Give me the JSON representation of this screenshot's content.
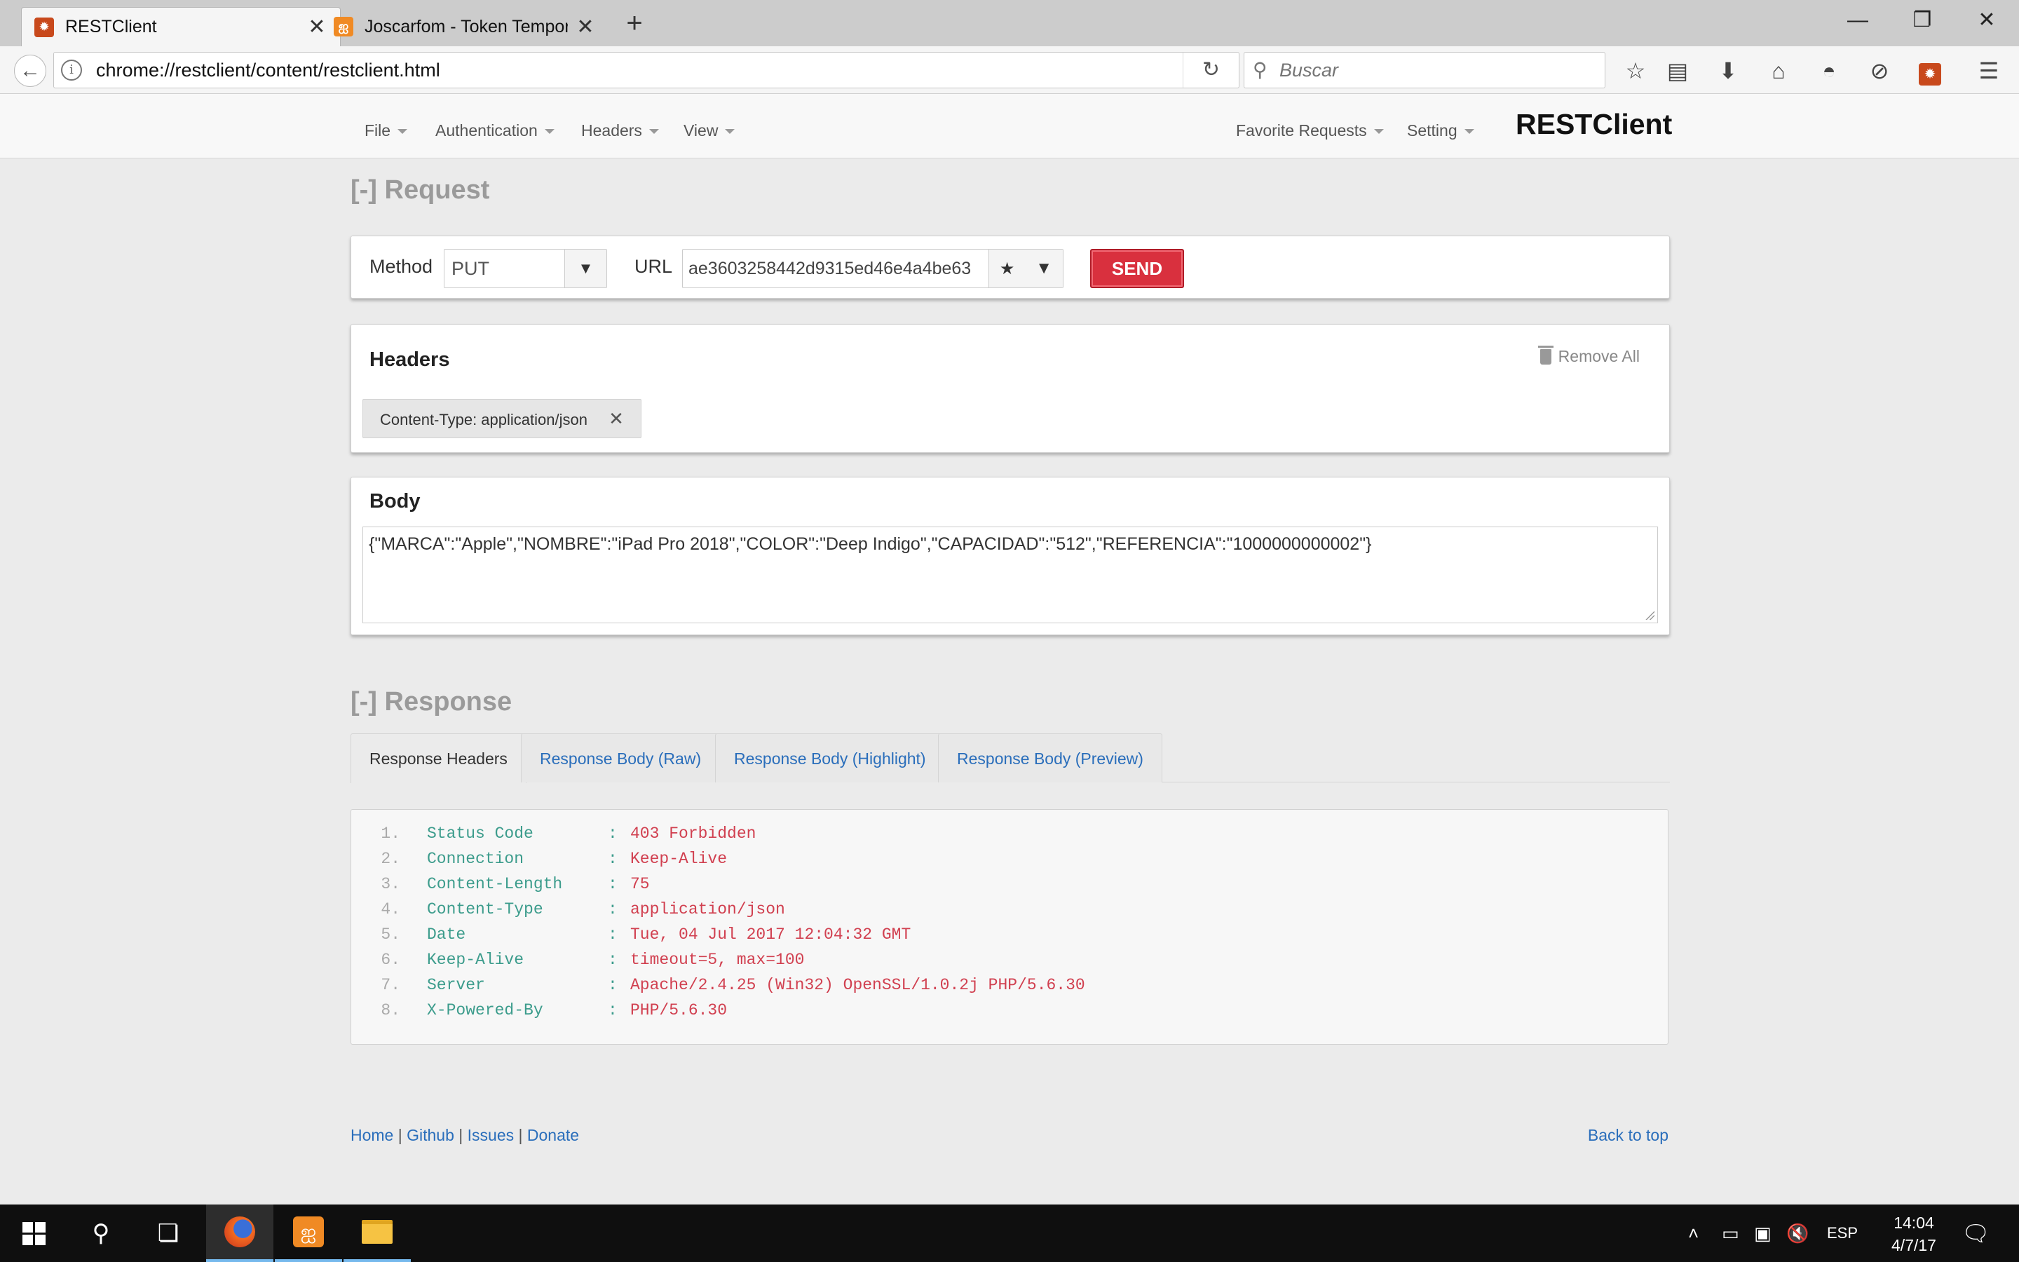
{
  "browser": {
    "tabs": [
      {
        "title": "RESTClient",
        "active": true
      },
      {
        "title": "Joscarfom - Token Temporal",
        "active": false
      }
    ],
    "address": "chrome://restclient/content/restclient.html",
    "search_placeholder": "Buscar",
    "icons": {
      "back": "arrow-left-icon",
      "info": "info-icon",
      "reload": "reload-icon",
      "bookmark": "star-icon",
      "reading": "reader-list-icon",
      "download": "download-icon",
      "home": "home-icon",
      "pocket": "pocket-icon",
      "sync": "sync-icon",
      "extension": "restclient-icon",
      "menu": "hamburger-icon"
    }
  },
  "app": {
    "brand": "RESTClient",
    "menu_left": [
      "File",
      "Authentication",
      "Headers",
      "View"
    ],
    "menu_right": [
      "Favorite Requests",
      "Setting"
    ],
    "request": {
      "title": "[-] Request",
      "method_label": "Method",
      "method_value": "PUT",
      "url_label": "URL",
      "url_value": "ae3603258442d9315ed46e4a4be63",
      "send_label": "SEND"
    },
    "headers": {
      "title": "Headers",
      "remove_all": "Remove All",
      "items": [
        "Content-Type: application/json"
      ]
    },
    "body": {
      "title": "Body",
      "content": "{\"MARCA\":\"Apple\",\"NOMBRE\":\"iPad Pro 2018\",\"COLOR\":\"Deep Indigo\",\"CAPACIDAD\":\"512\",\"REFERENCIA\":\"1000000000002\"}"
    },
    "response": {
      "title": "[-] Response",
      "tabs": [
        "Response Headers",
        "Response Body (Raw)",
        "Response Body (Highlight)",
        "Response Body (Preview)"
      ],
      "active_tab": "Response Headers",
      "headers": [
        {
          "num": "1.",
          "key": "Status Code",
          "value": "403 Forbidden"
        },
        {
          "num": "2.",
          "key": "Connection",
          "value": "Keep-Alive"
        },
        {
          "num": "3.",
          "key": "Content-Length",
          "value": "75"
        },
        {
          "num": "4.",
          "key": "Content-Type",
          "value": "application/json"
        },
        {
          "num": "5.",
          "key": "Date",
          "value": "Tue, 04 Jul 2017 12:04:32 GMT"
        },
        {
          "num": "6.",
          "key": "Keep-Alive",
          "value": "timeout=5, max=100"
        },
        {
          "num": "7.",
          "key": "Server",
          "value": "Apache/2.4.25 (Win32) OpenSSL/1.0.2j PHP/5.6.30"
        },
        {
          "num": "8.",
          "key": "X-Powered-By",
          "value": "PHP/5.6.30"
        }
      ],
      "separator": ":"
    },
    "footer": {
      "links": [
        "Home",
        "Github",
        "Issues",
        "Donate"
      ],
      "separator": "|",
      "back_to_top": "Back to top"
    }
  },
  "taskbar": {
    "apps": [
      "windows-start-icon",
      "search-icon",
      "task-view-icon",
      "firefox-icon",
      "xampp-icon",
      "file-explorer-icon"
    ],
    "language": "ESP",
    "time": "14:04",
    "date": "4/7/17"
  },
  "colors": {
    "send_button": "#d9303e",
    "link": "#2a6ebb",
    "response_key": "#3c9c8c",
    "response_value": "#d14050"
  }
}
